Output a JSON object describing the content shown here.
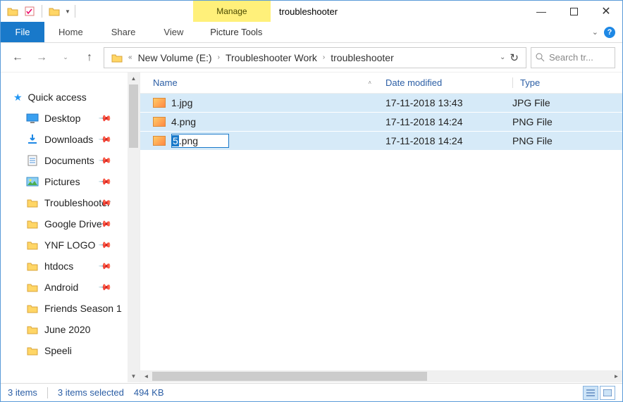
{
  "title": "troubleshooter",
  "manage_tab": "Manage",
  "ribbon": {
    "file": "File",
    "home": "Home",
    "share": "Share",
    "view": "View",
    "picture_tools": "Picture Tools"
  },
  "breadcrumb": [
    "New Volume (E:)",
    "Troubleshooter Work",
    "troubleshooter"
  ],
  "search": {
    "placeholder": "Search tr..."
  },
  "sidebar": {
    "quick_access": "Quick access",
    "items": [
      {
        "label": "Desktop",
        "icon": "desktop",
        "pinned": true
      },
      {
        "label": "Downloads",
        "icon": "downloads",
        "pinned": true
      },
      {
        "label": "Documents",
        "icon": "documents",
        "pinned": true
      },
      {
        "label": "Pictures",
        "icon": "pictures",
        "pinned": true
      },
      {
        "label": "Troubleshooter",
        "icon": "folder",
        "pinned": true
      },
      {
        "label": "Google Drive",
        "icon": "folder",
        "pinned": true
      },
      {
        "label": "YNF LOGO",
        "icon": "folder",
        "pinned": true
      },
      {
        "label": "htdocs",
        "icon": "folder",
        "pinned": true
      },
      {
        "label": "Android",
        "icon": "folder",
        "pinned": true
      },
      {
        "label": "Friends Season 1",
        "icon": "folder",
        "pinned": false
      },
      {
        "label": "June 2020",
        "icon": "folder",
        "pinned": false
      },
      {
        "label": "Speeli",
        "icon": "folder",
        "pinned": false
      }
    ]
  },
  "columns": {
    "name": "Name",
    "date": "Date modified",
    "type": "Type"
  },
  "files": [
    {
      "name": "1.jpg",
      "date": "17-11-2018 13:43",
      "type": "JPG File",
      "renaming": false
    },
    {
      "name": "4.png",
      "date": "17-11-2018 14:24",
      "type": "PNG File",
      "renaming": false
    },
    {
      "name": "5.png",
      "date": "17-11-2018 14:24",
      "type": "PNG File",
      "renaming": true,
      "sel": "5",
      "rest": ".png"
    }
  ],
  "status": {
    "count": "3 items",
    "selected": "3 items selected",
    "size": "494 KB"
  }
}
